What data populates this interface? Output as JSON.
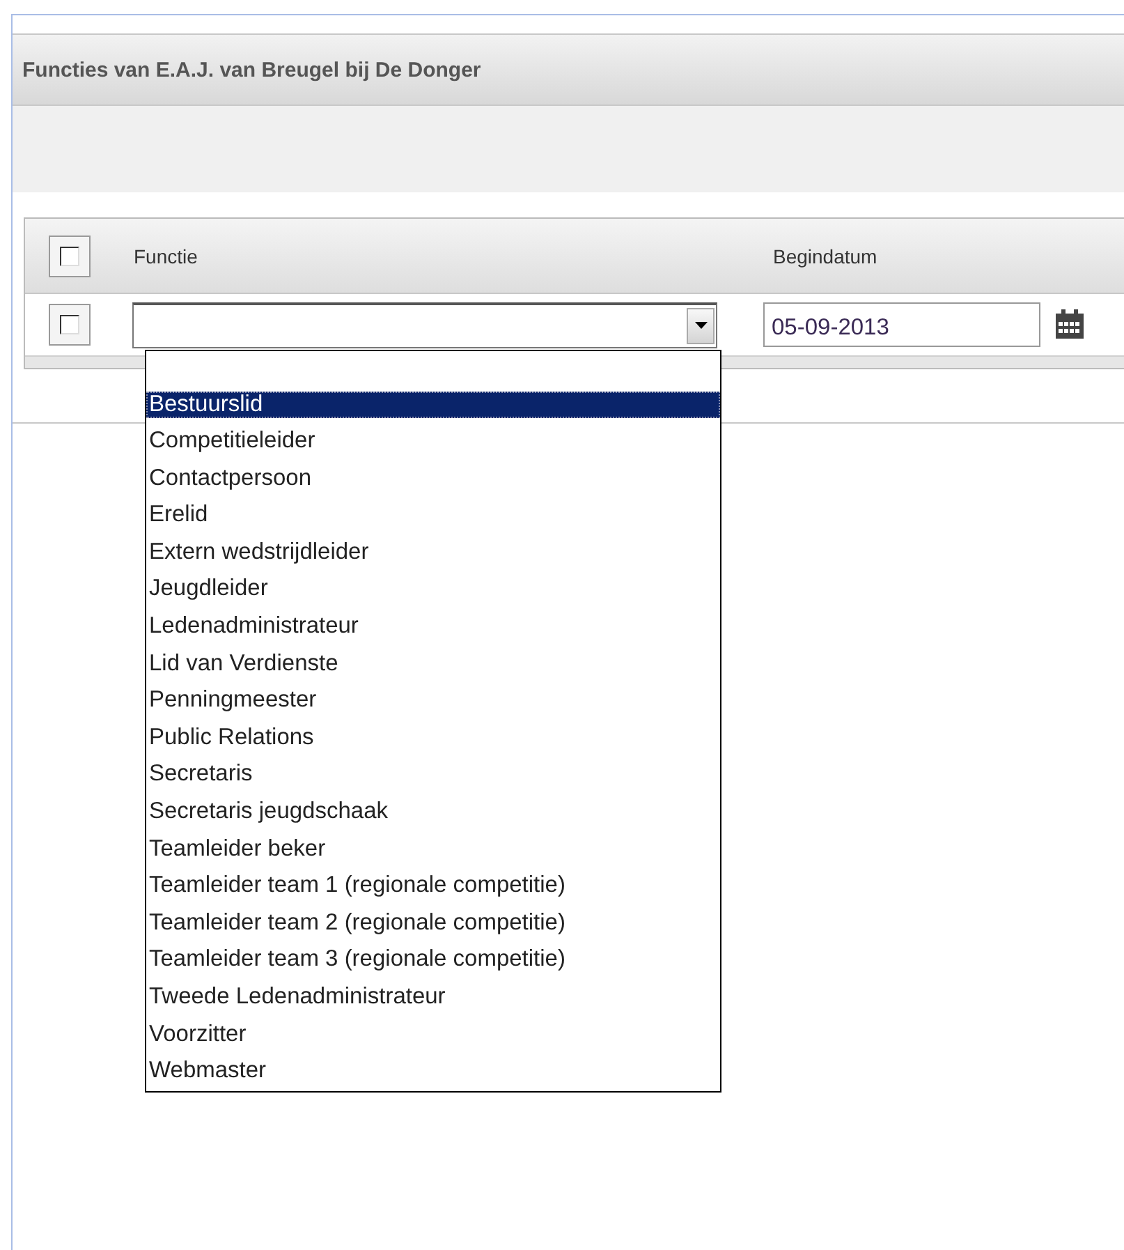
{
  "page": {
    "title": "Functies van E.A.J. van Breugel bij De Donger"
  },
  "table": {
    "select_all": {
      "checked": false
    },
    "columns": [
      "Functie",
      "Begindatum"
    ],
    "rows": [
      {
        "checked": false,
        "begindatum": "05-09-2013",
        "functie": {
          "expanded": true,
          "options": [
            {
              "label": "Bestuurslid",
              "selected": true
            },
            {
              "label": "Competitieleider",
              "selected": false
            },
            {
              "label": "Contactpersoon",
              "selected": false
            },
            {
              "label": "Erelid",
              "selected": false
            },
            {
              "label": "Extern wedstrijdleider",
              "selected": false
            },
            {
              "label": "Jeugdleider",
              "selected": false
            },
            {
              "label": "Ledenadministrateur",
              "selected": false
            },
            {
              "label": "Lid van Verdienste",
              "selected": false
            },
            {
              "label": "Penningmeester",
              "selected": false
            },
            {
              "label": "Public Relations",
              "selected": false
            },
            {
              "label": "Secretaris",
              "selected": false
            },
            {
              "label": "Secretaris jeugdschaak",
              "selected": false
            },
            {
              "label": "Teamleider beker",
              "selected": false
            },
            {
              "label": "Teamleider team 1 (regionale competitie)",
              "selected": false
            },
            {
              "label": "Teamleider team 2 (regionale competitie)",
              "selected": false
            },
            {
              "label": "Teamleider team 3 (regionale competitie)",
              "selected": false
            },
            {
              "label": "Tweede Ledenadministrateur",
              "selected": false
            },
            {
              "label": "Voorzitter",
              "selected": false
            },
            {
              "label": "Webmaster",
              "selected": false
            }
          ]
        }
      }
    ]
  }
}
